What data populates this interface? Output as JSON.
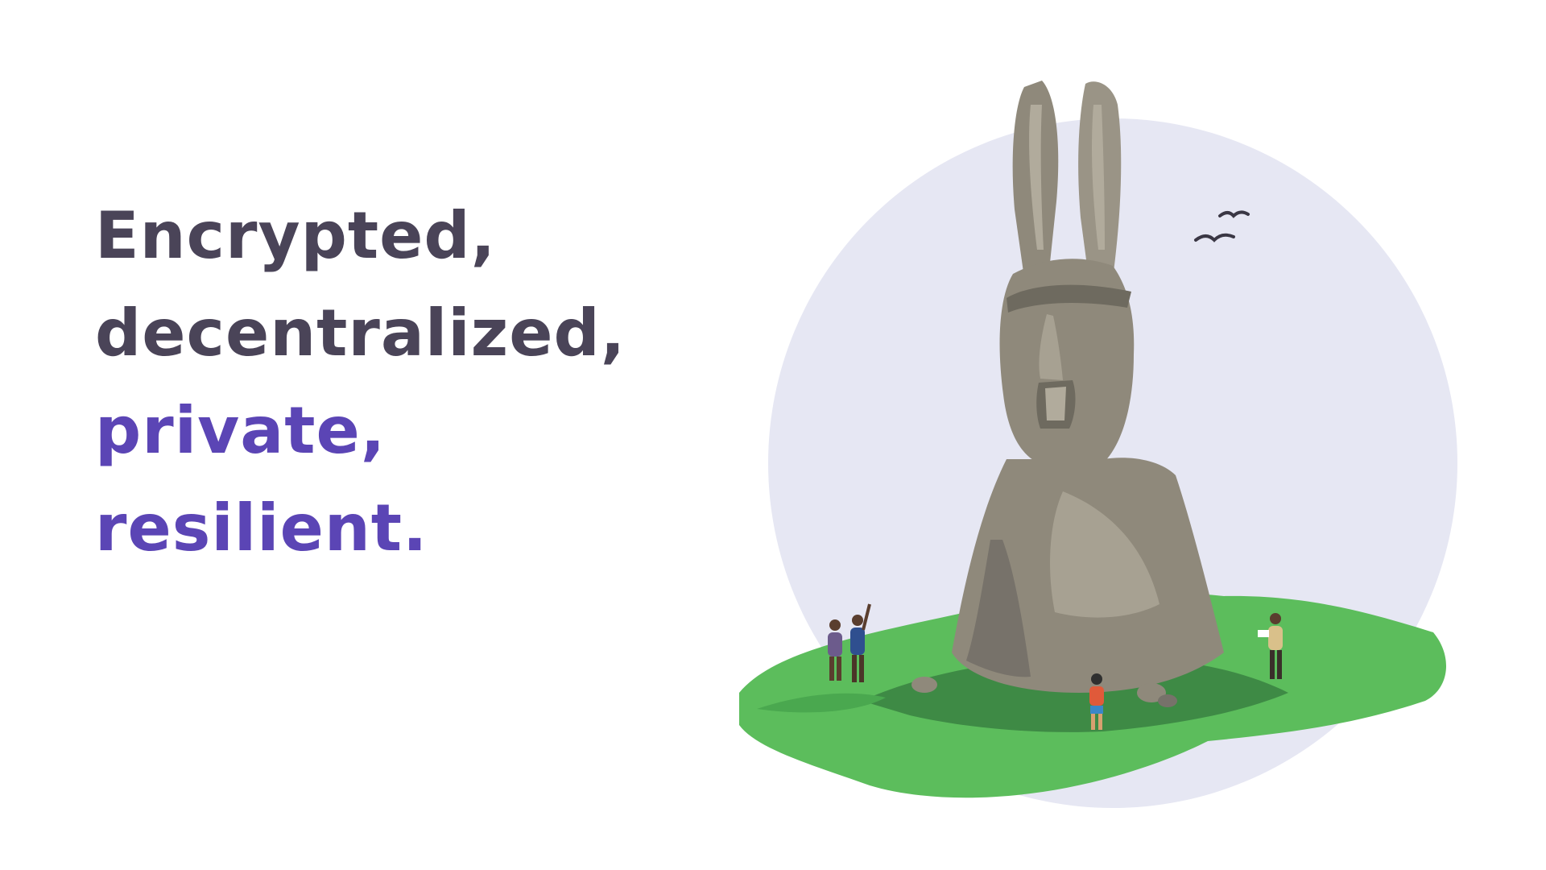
{
  "headline": {
    "line1": "Encrypted,",
    "line2": "decentralized,",
    "line3": "private,",
    "line4": "resilient."
  },
  "colors": {
    "text_dark": "#4a4458",
    "text_accent": "#5b45b5",
    "circle_bg": "#e6e7f3",
    "grass_light": "#5cbd5c",
    "grass_dark": "#3e8a45",
    "stone": "#8f897b"
  },
  "illustration": {
    "subject": "rabbit-eared stone statue on grassy island with people and birds"
  }
}
